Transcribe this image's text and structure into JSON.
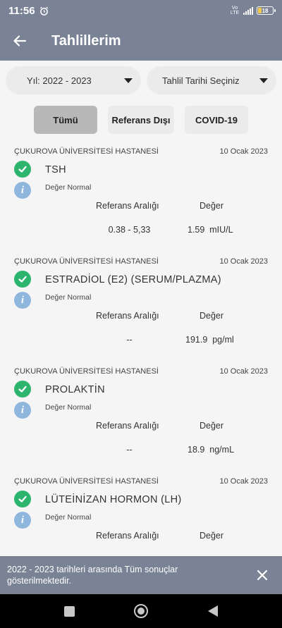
{
  "status_bar": {
    "time": "11:56",
    "network": "Vo LTE",
    "battery": "18"
  },
  "app_bar": {
    "title": "Tahlillerim"
  },
  "filters": {
    "year": "Yıl: 2022 - 2023",
    "date": "Tahlil Tarihi Seçiniz"
  },
  "tabs": [
    {
      "label": "Tümü",
      "active": true
    },
    {
      "label": "Referans Dışı",
      "active": false
    },
    {
      "label": "COVID-19",
      "active": false
    }
  ],
  "table_headers": {
    "ref_range": "Referans Aralığı",
    "value": "Değer"
  },
  "results": [
    {
      "hospital": "ÇUKUROVA ÜNİVERSİTESİ HASTANESİ",
      "date": "10 Ocak 2023",
      "test": "TSH",
      "status": "Değer Normal",
      "ref_range": "0.38 - 5,33",
      "value": "1.59  mIU/L"
    },
    {
      "hospital": "ÇUKUROVA ÜNİVERSİTESİ HASTANESİ",
      "date": "10 Ocak 2023",
      "test": "ESTRADİOL (E2) (SERUM/PLAZMA)",
      "status": "Değer Normal",
      "ref_range": "--",
      "value": "191.9  pg/ml"
    },
    {
      "hospital": "ÇUKUROVA ÜNİVERSİTESİ HASTANESİ",
      "date": "10 Ocak 2023",
      "test": "PROLAKTİN",
      "status": "Değer Normal",
      "ref_range": "--",
      "value": "18.9  ng/mL"
    },
    {
      "hospital": "ÇUKUROVA ÜNİVERSİTESİ HASTANESİ",
      "date": "10 Ocak 2023",
      "test": "LÜTEİNİZAN HORMON (LH)",
      "status": "Değer Normal",
      "ref_range": "",
      "value": ""
    }
  ],
  "snackbar": {
    "message": "2022 - 2023 tarihleri arasında Tüm sonuçlar gösterilmektedir."
  },
  "colors": {
    "header": "#7a8296",
    "success": "#2db56f",
    "info": "#8fb6dd"
  }
}
